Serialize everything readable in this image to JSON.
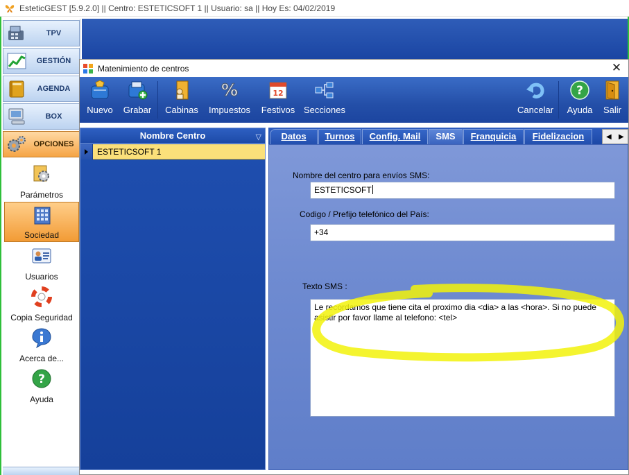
{
  "app": {
    "title": "EsteticGEST [5.9.2.0] || Centro: ESTETICSOFT 1  || Usuario: sa || Hoy Es: 04/02/2019"
  },
  "leftnav": {
    "buttons": [
      {
        "label": "TPV",
        "icon": "cash-register-icon"
      },
      {
        "label": "GESTIÓN",
        "icon": "chart-icon"
      },
      {
        "label": "AGENDA",
        "icon": "agenda-book-icon"
      },
      {
        "label": "BOX",
        "icon": "computer-icon"
      },
      {
        "label": "OPCIONES",
        "icon": "gears-icon",
        "active": true
      }
    ],
    "subitems": [
      {
        "label": "Parámetros",
        "icon": "parameters-gear-icon"
      },
      {
        "label": "Sociedad",
        "icon": "building-icon",
        "active": true
      },
      {
        "label": "Usuarios",
        "icon": "user-card-icon"
      },
      {
        "label": "Copia Seguridad",
        "icon": "lifebuoy-icon"
      },
      {
        "label": "Acerca de...",
        "icon": "info-icon"
      },
      {
        "label": "Ayuda",
        "icon": "help-icon"
      }
    ]
  },
  "dialog": {
    "title": "Matenimiento de centros",
    "close_icon": "close-icon"
  },
  "toolbar": {
    "nuevo": "Nuevo",
    "grabar": "Grabar",
    "cabinas": "Cabinas",
    "impuestos": "Impuestos",
    "festivos": "Festivos",
    "festivos_day": "12",
    "secciones": "Secciones",
    "cancelar": "Cancelar",
    "ayuda": "Ayuda",
    "salir": "Salir"
  },
  "grid": {
    "header": "Nombre Centro",
    "filter_glyph": "▽",
    "rows": [
      {
        "nombre": "ESTETICSOFT 1"
      }
    ]
  },
  "tabs": {
    "items": [
      "Datos",
      "Turnos",
      "Config. Mail",
      "SMS",
      "Franquicia",
      "Fidelizacion"
    ],
    "active": "SMS",
    "nav_left": "◀",
    "nav_right": "▶"
  },
  "sms": {
    "nombre_label": "Nombre del centro para envíos SMS:",
    "nombre_value": "ESTETICSOFT",
    "prefijo_label": "Codigo / Prefijo telefónico del País:",
    "prefijo_value": "+34",
    "texto_label": "Texto SMS :",
    "texto_value": "Le recordamos que tiene cita el proximo dia <dia> a las <hora>. Si no puede asistir por favor llame al telefono: <tel>"
  },
  "colors": {
    "accent_blue": "#1c45a0",
    "active_orange": "#f5a445",
    "selection_yellow": "#fbe07a",
    "highlight_marker": "#f2f20a",
    "window_border": "#2fbf3a"
  }
}
